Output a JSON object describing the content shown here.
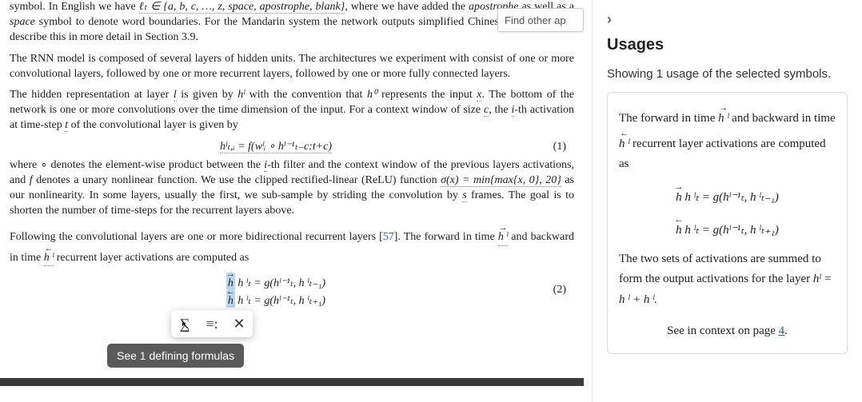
{
  "search": {
    "placeholder": "Find other ap"
  },
  "para1": {
    "lead": "symbol. In English we have ",
    "set": "ℓₜ ∈ {a, b, c, …, z, space, apostrophe, blank}",
    "tail1": ", where we have added the ",
    "apos": "apostrophe",
    "tail2": " as well as a ",
    "space": "space",
    "tail3": " symbol to denote word boundaries. For the Mandarin system the network outputs simplified Chinese characters. We describe this in more detail in Section 3.9."
  },
  "para2": "The RNN model is composed of several layers of hidden units. The architectures we experiment with consist of one or more convolutional layers, followed by one or more recurrent layers, followed by one or more fully connected layers.",
  "para3": {
    "a": "The hidden representation at layer ",
    "l": "l",
    "b": " is given by ",
    "hl": "hˡ",
    "c": " with the convention that ",
    "h0": "h⁰",
    "d": " represents the input ",
    "x": "x",
    "e": ". The bottom of the network is one or more convolutions over the time dimension of the input. For a context window of size ",
    "cc": "c",
    "f": ", the ",
    "ii": "i",
    "g": "-th activation at time-step ",
    "tt": "t",
    "h": " of the convolutional layer is given by"
  },
  "eq1": {
    "text": "hˡₜ,ᵢ = f(wˡᵢ ∘ hˡ⁻¹ₜ₋c:t+c)",
    "num": "(1)"
  },
  "para4": {
    "a": "where ∘ denotes the element-wise product between the ",
    "i": "i",
    "b": "-th filter and the context window of the previous layers activations, and ",
    "f": "f",
    "c": " denotes a unary nonlinear function. We use the clipped rectified-linear (ReLU) function ",
    "sig": "σ(x) = min{max{x, 0}, 20}",
    "d": " as our nonlinearity. In some layers, usually the first, we sub-sample by striding the convolution by ",
    "s": "s",
    "e": " frames. The goal is to shorten the number of time-steps for the recurrent layers above."
  },
  "para5": {
    "a": "Following the convolutional layers are one or more bidirectional recurrent layers [",
    "ref": "57",
    "b": "]. ",
    "bold": "The forward in time ",
    "hfwd": "h ˡ",
    "bold2": " and backward in time ",
    "hbwd": "h ˡ",
    "bold3": " recurrent layer activations are computed as"
  },
  "eq2": {
    "line1": "h ˡₜ = g(hˡ⁻¹ₜ, h ˡₜ₋₁)",
    "line2": "h ˡₜ = g(hˡ⁻¹ₜ, h ˡₜ₊₁)",
    "num": "(2)"
  },
  "toolbar": {
    "tooltip": "See 1 defining formulas"
  },
  "panel": {
    "title": "Usages",
    "subtitle": "Showing 1 usage of the selected symbols.",
    "card": {
      "t1": "The forward in time ",
      "t2": " and backward in time ",
      "t3": " recurrent layer activations are computed as",
      "eq1": "h ˡₜ = g(hˡ⁻¹ₜ, h ˡₜ₋₁)",
      "eq2": "h ˡₜ = g(hˡ⁻¹ₜ, h ˡₜ₊₁)",
      "t4": "The two sets of activations are summed to form the output activations for the layer ",
      "t5": "hˡ = h ˡ + h ˡ.",
      "link_a": "See in context on page ",
      "link_b": "4",
      "link_c": "."
    }
  }
}
